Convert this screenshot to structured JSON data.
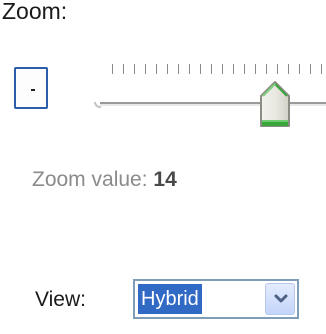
{
  "zoom": {
    "heading": "Zoom:",
    "zoom_out_label": "-",
    "value_label": "Zoom value: ",
    "value": "14",
    "slider_level_fraction": 0.63
  },
  "view": {
    "label": "View:",
    "selected": "Hybrid"
  },
  "icons": {
    "slider_thumb": "slider-thumb-icon",
    "dropdown": "chevron-down-icon"
  },
  "colors": {
    "focus_border": "#2b5ea8",
    "selection": "#316ac5",
    "thumb_accent": "#3aa53a",
    "muted_text": "#8b8b8b"
  }
}
